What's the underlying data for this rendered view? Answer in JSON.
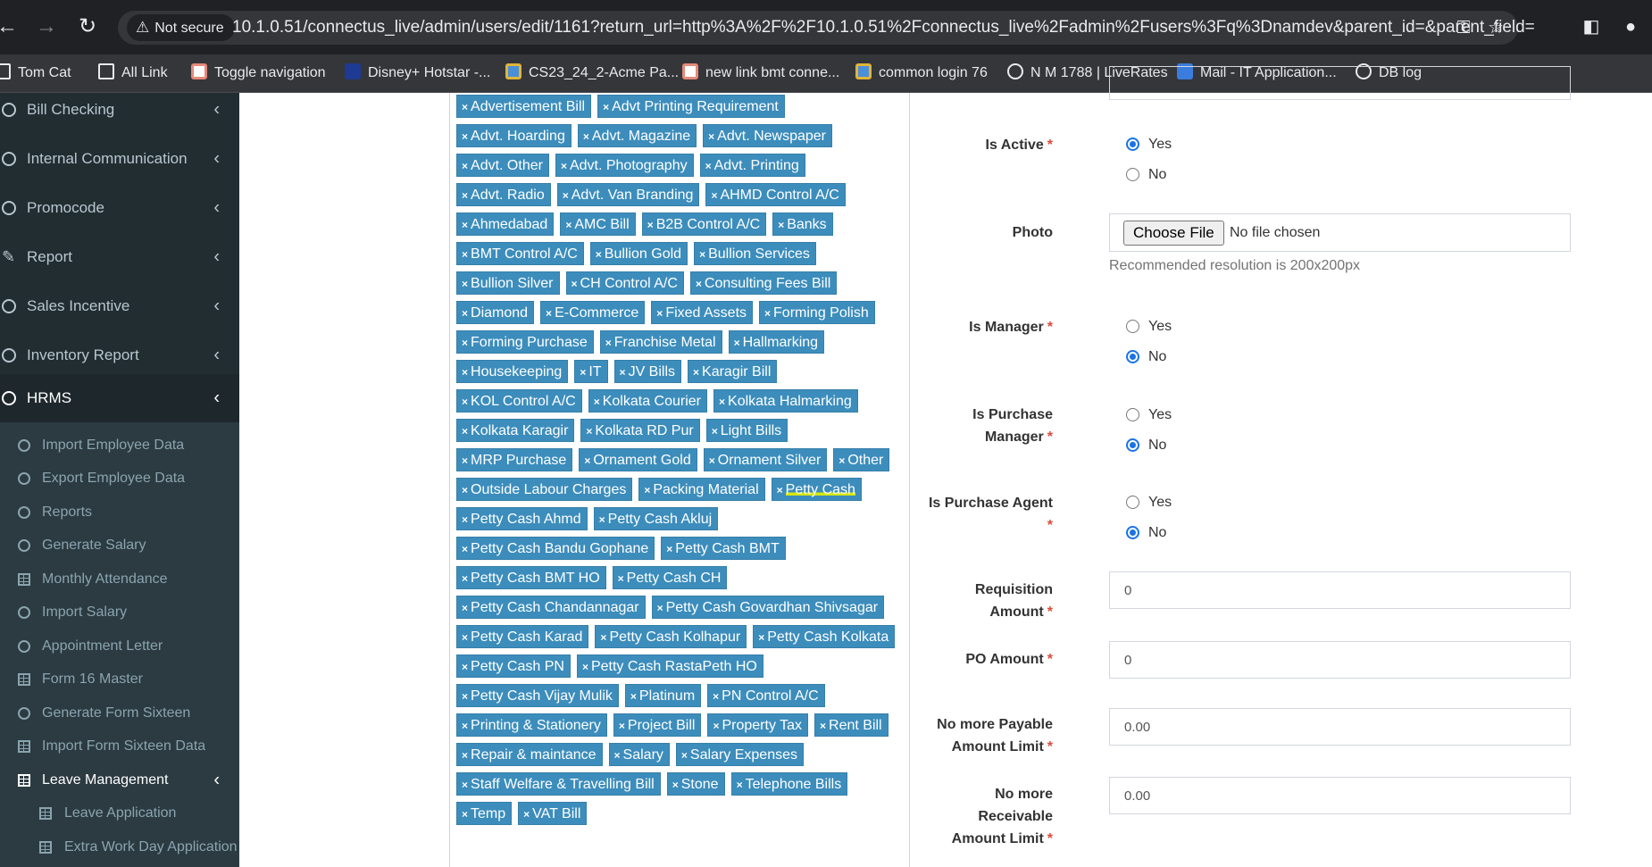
{
  "browser": {
    "security_label": "Not secure",
    "url": "10.1.0.51/connectus_live/admin/users/edit/1161?return_url=http%3A%2F%2F10.1.0.51%2Fconnectus_live%2Fadmin%2Fusers%3Fq%3Dnamdev&parent_id=&parent_field=",
    "bookmarks": [
      {
        "label": "Tom Cat",
        "icon": "folder-icon",
        "color": "#e8eaed"
      },
      {
        "label": "All Link",
        "icon": "folder-icon",
        "color": "#e8eaed"
      },
      {
        "label": "Toggle navigation",
        "icon": "site-icon",
        "color": "#e58a7a"
      },
      {
        "label": "Disney+ Hotstar -...",
        "icon": "hotstar-icon",
        "color": "#1f3a93"
      },
      {
        "label": "CS23_24_2-Acme Pa...",
        "icon": "acme-icon",
        "color": "#4a90d9"
      },
      {
        "label": "new link bmt conne...",
        "icon": "site-icon",
        "color": "#e58a7a"
      },
      {
        "label": "common login 76",
        "icon": "acme-icon",
        "color": "#4a90d9"
      },
      {
        "label": "N M 1788 | LiveRates",
        "icon": "globe-icon",
        "color": "#e8eaed"
      },
      {
        "label": "Mail - IT Application...",
        "icon": "mail-icon",
        "color": "#3b7ddd"
      },
      {
        "label": "DB log",
        "icon": "globe-icon",
        "color": "#e8eaed"
      }
    ]
  },
  "sidebar": {
    "menu": [
      {
        "label": "Bill Checking",
        "icon": "circle-icon"
      },
      {
        "label": "Internal Communication",
        "icon": "circle-icon"
      },
      {
        "label": "Promocode",
        "icon": "circle-icon"
      },
      {
        "label": "Report",
        "icon": "pencil-icon"
      },
      {
        "label": "Sales Incentive",
        "icon": "circle-icon"
      },
      {
        "label": "Inventory Report",
        "icon": "circle-icon"
      },
      {
        "label": "HRMS",
        "icon": "circle-icon"
      }
    ],
    "hrms_items": [
      {
        "label": "Import Employee Data",
        "icon": "circle"
      },
      {
        "label": "Export Employee Data",
        "icon": "circle"
      },
      {
        "label": "Reports",
        "icon": "circle"
      },
      {
        "label": "Generate Salary",
        "icon": "circle"
      },
      {
        "label": "Monthly Attendance",
        "icon": "grid"
      },
      {
        "label": "Import Salary",
        "icon": "circle"
      },
      {
        "label": "Appointment Letter",
        "icon": "circle"
      },
      {
        "label": "Form 16 Master",
        "icon": "grid"
      },
      {
        "label": "Generate Form Sixteen",
        "icon": "circle"
      },
      {
        "label": "Import Form Sixteen Data",
        "icon": "grid"
      },
      {
        "label": "Leave Management",
        "icon": "grid"
      },
      {
        "label": "Leave Application",
        "icon": "grid"
      },
      {
        "label": "Extra Work Day Application",
        "icon": "grid"
      }
    ]
  },
  "tags": [
    "Advertisement Bill",
    "Advt Printing Requirement",
    "Advt. Hoarding",
    "Advt. Magazine",
    "Advt. Newspaper",
    "Advt. Other",
    "Advt. Photography",
    "Advt. Printing",
    "Advt. Radio",
    "Advt. Van Branding",
    "AHMD Control A/C",
    "Ahmedabad",
    "AMC Bill",
    "B2B Control A/C",
    "Banks",
    "BMT Control A/C",
    "Bullion Gold",
    "Bullion Services",
    "Bullion Silver",
    "CH Control A/C",
    "Consulting Fees Bill",
    "Diamond",
    "E-Commerce",
    "Fixed Assets",
    "Forming Polish",
    "Forming Purchase",
    "Franchise Metal",
    "Hallmarking",
    "Housekeeping",
    "IT",
    "JV Bills",
    "Karagir Bill",
    "KOL Control A/C",
    "Kolkata Courier",
    "Kolkata Halmarking",
    "Kolkata Karagir",
    "Kolkata RD Pur",
    "Light Bills",
    "MRP Purchase",
    "Ornament Gold",
    "Ornament Silver",
    "Other",
    "Outside Labour Charges",
    "Packing Material",
    "Petty Cash",
    "Petty Cash Ahmd",
    "Petty Cash Akluj",
    "Petty Cash Bandu Gophane",
    "Petty Cash BMT",
    "Petty Cash BMT HO",
    "Petty Cash CH",
    "Petty Cash Chandannagar",
    "Petty Cash Govardhan Shivsagar",
    "Petty Cash Karad",
    "Petty Cash Kolhapur",
    "Petty Cash Kolkata",
    "Petty Cash PN",
    "Petty Cash RastaPeth HO",
    "Petty Cash Vijay Mulik",
    "Platinum",
    "PN Control A/C",
    "Printing & Stationery",
    "Project Bill",
    "Property Tax",
    "Rent Bill",
    "Repair & maintance",
    "Salary",
    "Salary Expenses",
    "Staff Welfare & Travelling Bill",
    "Stone",
    "Telephone Bills",
    "Temp",
    "VAT Bill"
  ],
  "highlighted_tag": "Petty Cash",
  "form": {
    "is_active": {
      "label": "Is Active",
      "yes": "Yes",
      "no": "No",
      "selected": "Yes"
    },
    "photo": {
      "label": "Photo",
      "button": "Choose File",
      "status": "No file chosen",
      "help": "Recommended resolution is 200x200px"
    },
    "is_manager": {
      "label": "Is Manager",
      "yes": "Yes",
      "no": "No",
      "selected": "No"
    },
    "is_purchase_manager": {
      "label_line1": "Is Purchase",
      "label_line2": "Manager",
      "yes": "Yes",
      "no": "No",
      "selected": "No"
    },
    "is_purchase_agent": {
      "label": "Is Purchase Agent",
      "yes": "Yes",
      "no": "No",
      "selected": "No"
    },
    "requisition_amount": {
      "label_line1": "Requisition",
      "label_line2": "Amount",
      "value": "0"
    },
    "po_amount": {
      "label": "PO Amount",
      "value": "0"
    },
    "no_more_payable": {
      "label_line1": "No more Payable",
      "label_line2": "Amount Limit",
      "value": "0.00"
    },
    "no_more_receivable": {
      "label_line1": "No more",
      "label_line2": "Receivable",
      "label_line3": "Amount Limit",
      "value": "0.00"
    },
    "required_mark": "*"
  }
}
